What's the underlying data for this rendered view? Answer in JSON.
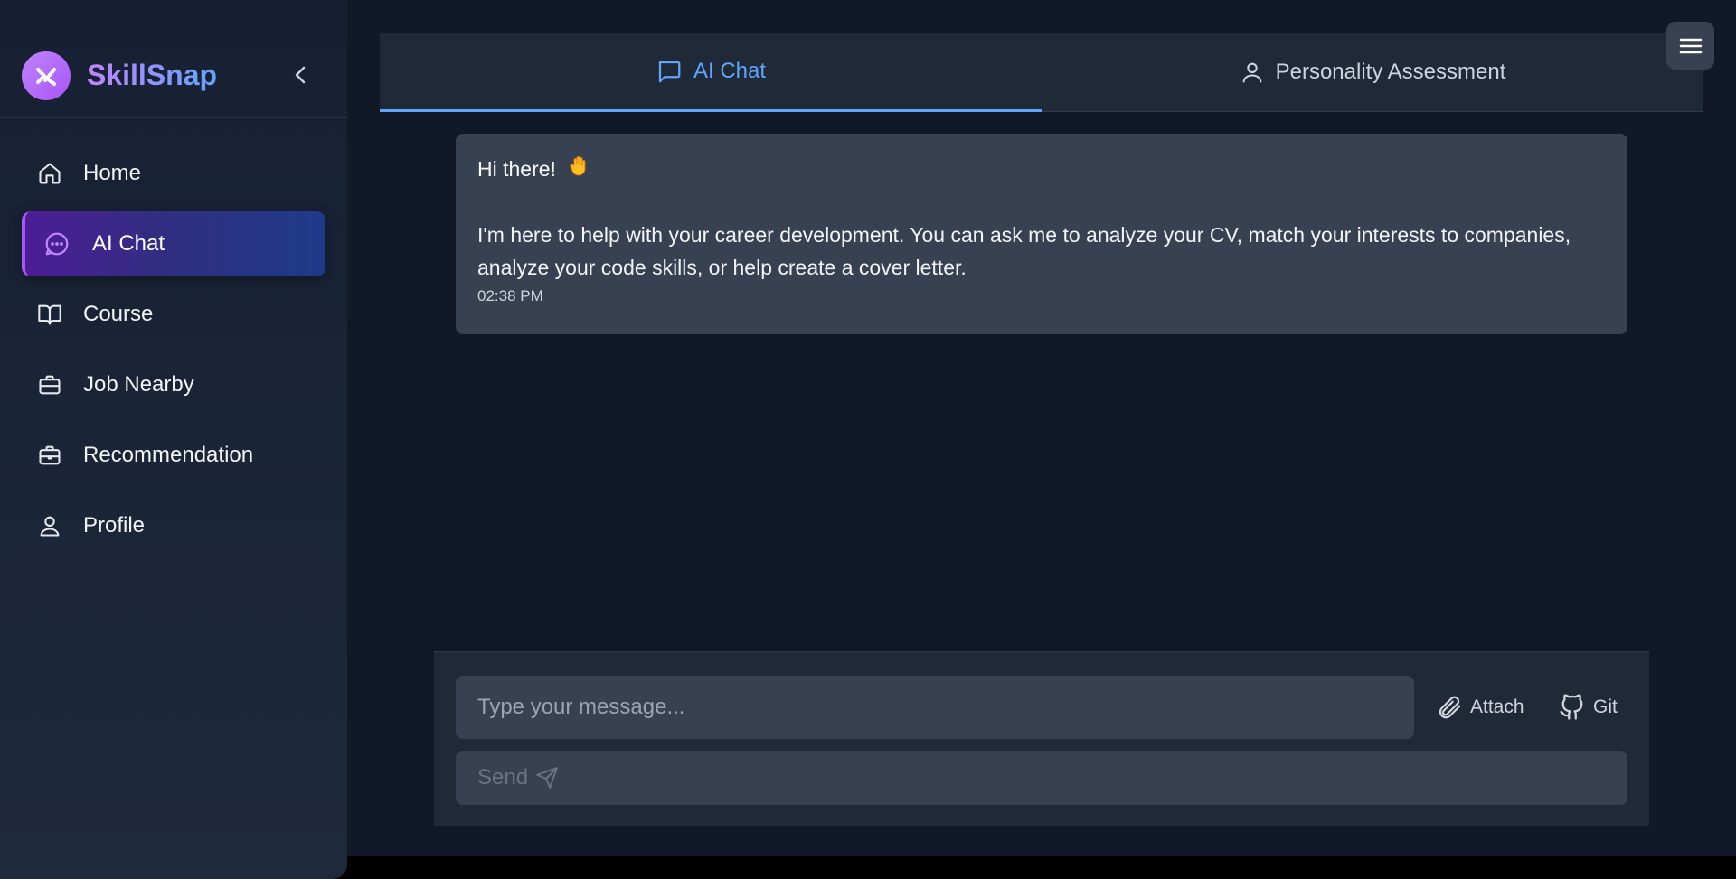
{
  "brand": {
    "name": "SkillSnap"
  },
  "sidebar": {
    "items": [
      {
        "label": "Home",
        "icon": "home-icon"
      },
      {
        "label": "AI Chat",
        "icon": "chat-bubble-icon",
        "active": true
      },
      {
        "label": "Course",
        "icon": "book-icon"
      },
      {
        "label": "Job Nearby",
        "icon": "briefcase-icon"
      },
      {
        "label": "Recommendation",
        "icon": "briefcase-icon"
      },
      {
        "label": "Profile",
        "icon": "user-icon"
      }
    ]
  },
  "tabs": [
    {
      "label": "AI Chat",
      "icon": "chat-bubble-icon",
      "active": true
    },
    {
      "label": "Personality Assessment",
      "icon": "user-icon",
      "active": false
    }
  ],
  "message": {
    "greeting": "Hi there!",
    "body": "I'm here to help with your career development. You can ask me to analyze your CV, match your interests to companies, analyze your code skills, or help create a cover letter.",
    "time": "02:38 PM"
  },
  "composer": {
    "placeholder": "Type your message...",
    "attach_label": "Attach",
    "git_label": "Git",
    "send_label": "Send"
  },
  "colors": {
    "accent": "#60a5fa",
    "brand_purple": "#a855f7",
    "background": "#111827",
    "panel": "#1f2937",
    "bubble": "#374151"
  }
}
